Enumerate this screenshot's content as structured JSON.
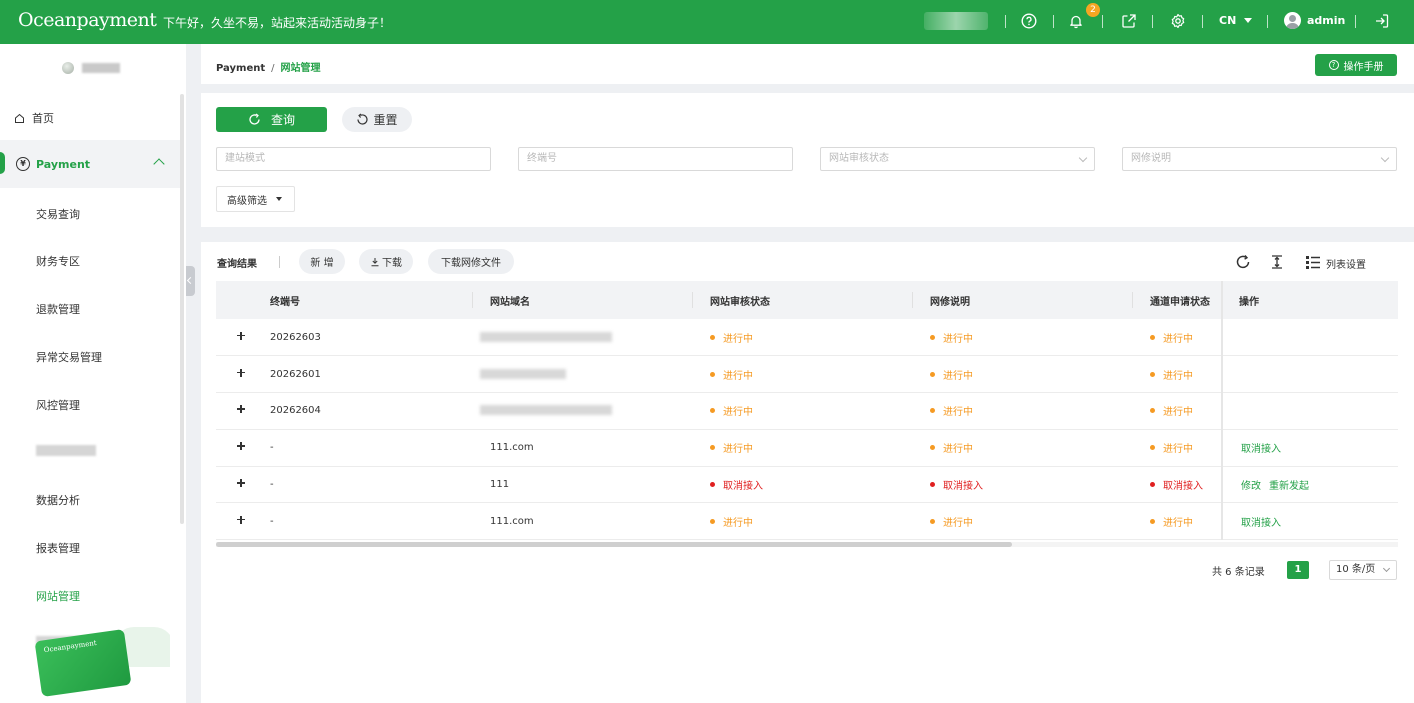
{
  "topbar": {
    "logo": "Oceanpayment",
    "greeting": "下午好，久坐不易，站起来活动活动身子！",
    "notification_count": "2",
    "language": "CN",
    "username": "admin",
    "icons": [
      "help-icon",
      "bell-icon",
      "external-link-icon",
      "settings-icon",
      "logout-icon"
    ],
    "bg_color": "#24a148"
  },
  "sidebar": {
    "home": "首页",
    "payment": "Payment",
    "items": [
      "交易查询",
      "财务专区",
      "退款管理",
      "异常交易管理",
      "风控管理",
      "数据分析",
      "报表管理",
      "网站管理"
    ],
    "active": "网站管理"
  },
  "breadcrumb": {
    "root": "Payment",
    "separator": "/",
    "current": "网站管理",
    "manual_button": "操作手册"
  },
  "filters": {
    "query_button": "查询",
    "reset_button": "重置",
    "field1_placeholder": "建站模式",
    "field2_placeholder": "终端号",
    "field3_placeholder": "网站审核状态",
    "field4_placeholder": "网修说明",
    "advanced_button": "高级筛选"
  },
  "results": {
    "title": "查询结果",
    "add_button": "新 增",
    "download_button": "下载",
    "download_repair_button": "下载网修文件",
    "column_settings": "列表设置",
    "columns": [
      "终端号",
      "网站域名",
      "网站审核状态",
      "网修说明",
      "通道申请状态",
      "操作"
    ],
    "rows": [
      {
        "terminal": "20262603",
        "domain": "",
        "audit": "进行中",
        "repair": "进行中",
        "channel": "进行中",
        "actions": []
      },
      {
        "terminal": "20262601",
        "domain": "",
        "audit": "进行中",
        "repair": "进行中",
        "channel": "进行中",
        "actions": []
      },
      {
        "terminal": "20262604",
        "domain": "",
        "audit": "进行中",
        "repair": "进行中",
        "channel": "进行中",
        "actions": []
      },
      {
        "terminal": "-",
        "domain": "111.com",
        "audit": "进行中",
        "repair": "进行中",
        "channel": "进行中",
        "actions": [
          "取消接入"
        ]
      },
      {
        "terminal": "-",
        "domain": "111",
        "audit": "取消接入",
        "repair": "取消接入",
        "channel": "取消接入",
        "actions": [
          "修改",
          "重新发起"
        ]
      },
      {
        "terminal": "-",
        "domain": "111.com",
        "audit": "进行中",
        "repair": "进行中",
        "channel": "进行中",
        "actions": [
          "取消接入"
        ]
      }
    ]
  },
  "pagination": {
    "total": "共 6 条记录",
    "current_page": "1",
    "page_size": "10 条/页"
  },
  "colors": {
    "accent": "#24a148",
    "status_in_progress": "#f59a23",
    "status_cancelled": "#e02020"
  }
}
